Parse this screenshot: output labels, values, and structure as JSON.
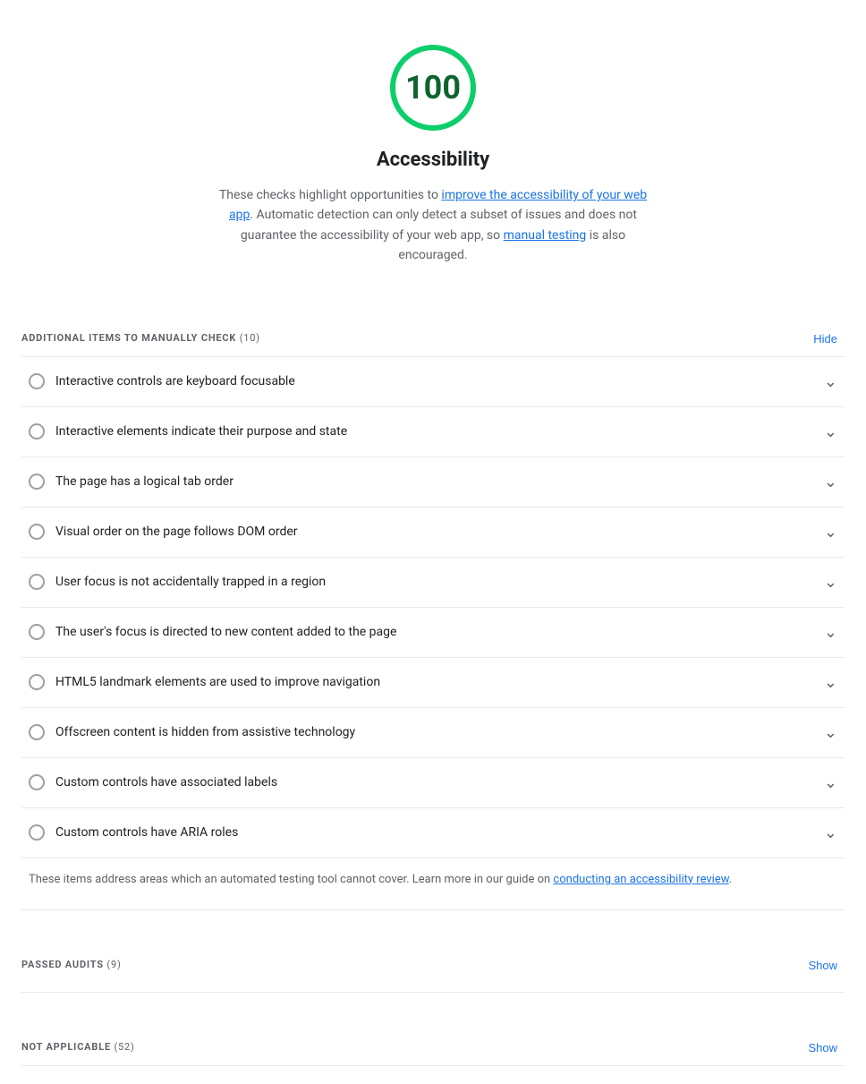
{
  "score": {
    "value": "100",
    "color": "#0cce6b",
    "text_color": "#0d652d",
    "title": "Accessibility",
    "description_1": "These checks highlight opportunities to ",
    "link1_text": "improve the accessibility of your web app",
    "link1_href": "#",
    "description_2": ". Automatic detection can only detect a subset of issues and does not guarantee the accessibility of your web app, so ",
    "link2_text": "manual testing",
    "link2_href": "#",
    "description_3": " is also encouraged."
  },
  "manual_section": {
    "title": "ADDITIONAL ITEMS TO MANUALLY CHECK",
    "count": "(10)",
    "toggle_label": "Hide"
  },
  "audit_items": [
    {
      "id": "item-0",
      "label": "Interactive controls are keyboard focusable"
    },
    {
      "id": "item-1",
      "label": "Interactive elements indicate their purpose and state"
    },
    {
      "id": "item-2",
      "label": "The page has a logical tab order"
    },
    {
      "id": "item-3",
      "label": "Visual order on the page follows DOM order"
    },
    {
      "id": "item-4",
      "label": "User focus is not accidentally trapped in a region"
    },
    {
      "id": "item-5",
      "label": "The user's focus is directed to new content added to the page"
    },
    {
      "id": "item-6",
      "label": "HTML5 landmark elements are used to improve navigation"
    },
    {
      "id": "item-7",
      "label": "Offscreen content is hidden from assistive technology"
    },
    {
      "id": "item-8",
      "label": "Custom controls have associated labels"
    },
    {
      "id": "item-9",
      "label": "Custom controls have ARIA roles"
    }
  ],
  "footer_note": {
    "text_before": "These items address areas which an automated testing tool cannot cover. Learn more in our guide on ",
    "link_text": "conducting an accessibility review",
    "link_href": "#",
    "text_after": "."
  },
  "passed_section": {
    "title": "PASSED AUDITS",
    "count": "(9)",
    "toggle_label": "Show"
  },
  "not_applicable_section": {
    "title": "NOT APPLICABLE",
    "count": "(52)",
    "toggle_label": "Show"
  }
}
